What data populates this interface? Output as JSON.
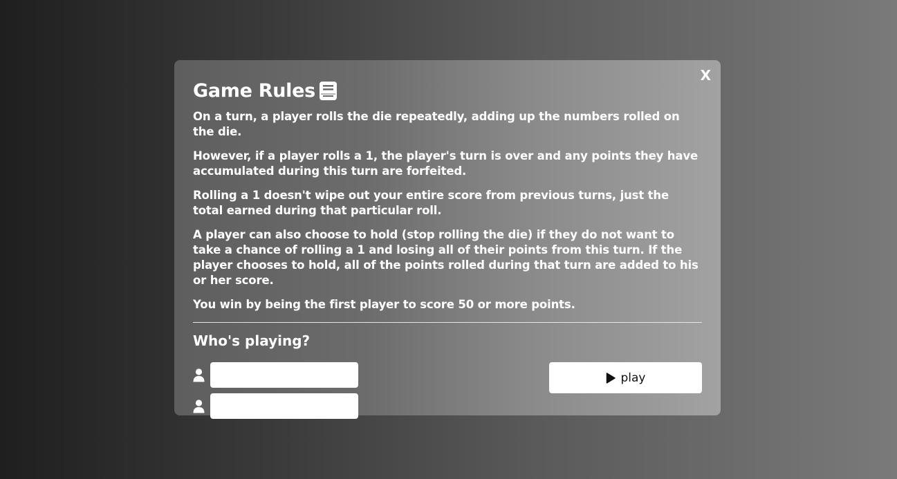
{
  "modal": {
    "title": "Game Rules",
    "title_icon": "book-icon",
    "close_label": "X",
    "rules": [
      "On a turn, a player rolls the die repeatedly, adding up the numbers rolled on the die.",
      "However, if a player rolls a 1, the player's turn is over and any points they have accumulated during this turn are forfeited.",
      "Rolling a 1 doesn't wipe out your entire score from previous turns, just the total earned during that particular roll.",
      "A player can also choose to hold (stop rolling the die) if they do not want to take a chance of rolling a 1 and losing all of their points from this turn. If the player chooses to hold, all of the points rolled during that turn are added to his or her score.",
      "You win by being the first player to score 50 or more points."
    ],
    "players_heading": "Who's playing?",
    "players": [
      {
        "icon": "user-icon",
        "value": "",
        "placeholder": ""
      },
      {
        "icon": "user-icon",
        "value": "",
        "placeholder": ""
      }
    ],
    "play_button": {
      "label": "play",
      "icon": "play-icon"
    }
  }
}
